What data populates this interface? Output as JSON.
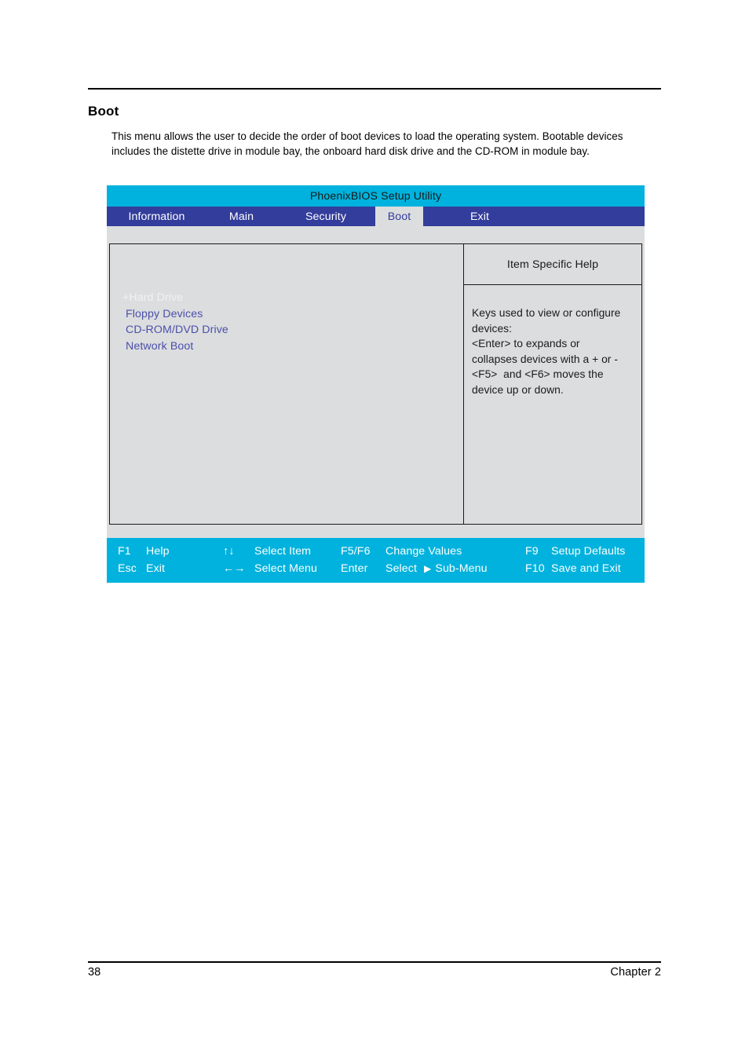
{
  "document": {
    "section_title": "Boot",
    "section_body": "This menu allows the user to decide the order of boot devices to load the operating system. Bootable devices includes the distette drive in module bay, the onboard hard disk drive and the CD-ROM in module bay.",
    "page_number": "38",
    "chapter": "Chapter 2"
  },
  "bios": {
    "title": "PhoenixBIOS Setup Utility",
    "tabs": [
      {
        "label": "Information",
        "selected": false
      },
      {
        "label": "Main",
        "selected": false
      },
      {
        "label": "Security",
        "selected": false
      },
      {
        "label": "Boot",
        "selected": true
      },
      {
        "label": "Exit",
        "selected": false
      }
    ],
    "boot_order": [
      {
        "label": "+Hard Drive",
        "selected": true
      },
      {
        "label": " Floppy Devices",
        "selected": false
      },
      {
        "label": " CD-ROM/DVD Drive",
        "selected": false
      },
      {
        "label": " Network Boot",
        "selected": false
      }
    ],
    "help": {
      "header": "Item Specific Help",
      "lines": [
        "Keys used to view or configure",
        "devices:",
        "<Enter> to expands or",
        "collapses devices with a + or -",
        "<F5>  and <F6> moves the",
        "device up or down."
      ]
    },
    "keybar": {
      "row1": [
        {
          "key": "F1",
          "desc": "Help"
        },
        {
          "key": "↑↓",
          "desc": "Select Item"
        },
        {
          "key": "F5/F6",
          "desc": "Change Values"
        },
        {
          "key": "F9",
          "desc": "Setup Defaults"
        }
      ],
      "row2": [
        {
          "key": "Esc",
          "desc": "Exit"
        },
        {
          "key": "←→",
          "desc": "Select Menu"
        },
        {
          "key": "Enter",
          "desc": "Select",
          "desc2": "Sub-Menu",
          "marker": "▶"
        },
        {
          "key": "F10",
          "desc": "Save and Exit"
        }
      ]
    },
    "colors": {
      "title_bar": "#00b2dd",
      "tab_bar": "#333d9b",
      "panel_bg": "#dcdddf",
      "menu_text": "#4a50a8",
      "selected_text": "#f2f2f4",
      "keybar": "#00b2dd"
    }
  }
}
